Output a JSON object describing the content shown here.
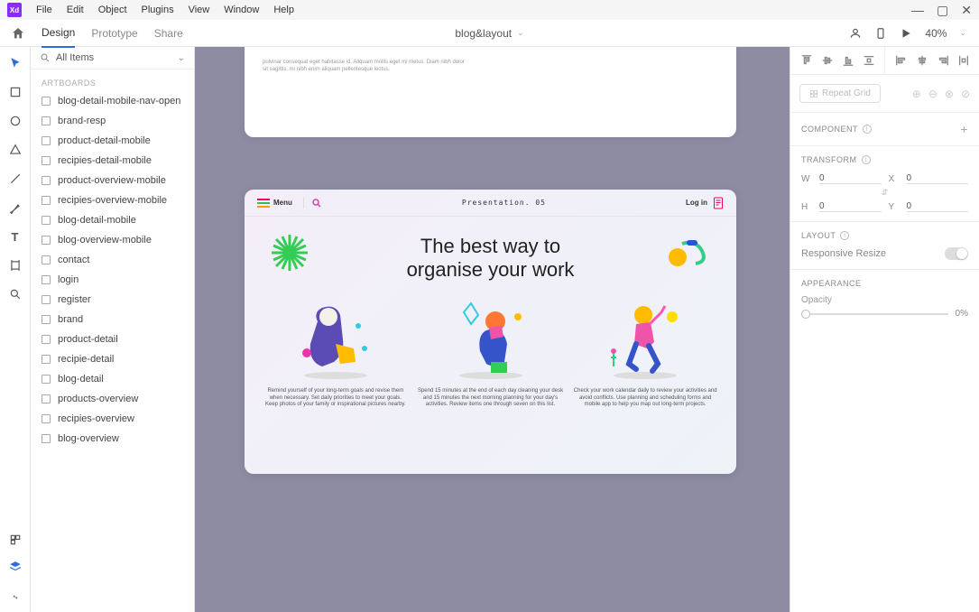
{
  "app": {
    "short": "Xd"
  },
  "menubar": [
    "File",
    "Edit",
    "Object",
    "Plugins",
    "View",
    "Window",
    "Help"
  ],
  "subbar": {
    "tabs": [
      "Design",
      "Prototype",
      "Share"
    ],
    "active_tab": 0,
    "doc_title": "blog&layout",
    "zoom": "40%"
  },
  "left_panel": {
    "filter_label": "All Items",
    "section": "ARTBOARDS",
    "artboards": [
      "blog-detail-mobile-nav-open",
      "brand-resp",
      "product-detail-mobile",
      "recipies-detail-mobile",
      "product-overview-mobile",
      "recipies-overview-mobile",
      "blog-detail-mobile",
      "blog-overview-mobile",
      "contact",
      "login",
      "register",
      "brand",
      "product-detail",
      "recipie-detail",
      "blog-detail",
      "products-overview",
      "recipies-overview",
      "blog-overview"
    ]
  },
  "canvas": {
    "lorem_top": "pulvinar consequat eget habitasse id. Aliquam mollis eget mi metus. Diam nibh dolor sit sagittis, mi nibh enim aliquam pellentesque lectus.",
    "artboard": {
      "menu_label": "Menu",
      "title": "Presentation. 05",
      "login_label": "Log in",
      "hero_line1": "The best way to",
      "hero_line2": "organise your work",
      "cols": [
        "Remind yourself of your long-term goals and revise them when necessary. Set daily priorities to meet your goals. Keep photos of your family or inspirational pictures nearby.",
        "Spend 15 minutes at the end of each day cleaning your desk and 15 minutes the next morning planning for your day's activities. Review items one through seven on this list.",
        "Check your work calendar daily to review your activities and avoid conflicts. Use planning and scheduling forms and mobile app to help you map out long-term projects."
      ]
    }
  },
  "right_panel": {
    "repeat_label": "Repeat Grid",
    "component_label": "COMPONENT",
    "transform_label": "TRANSFORM",
    "transform": {
      "w": "0",
      "x": "0",
      "h": "0",
      "y": "0"
    },
    "layout_label": "LAYOUT",
    "responsive_label": "Responsive Resize",
    "appearance_label": "APPEARANCE",
    "opacity_label": "Opacity",
    "opacity_value": "0%"
  }
}
